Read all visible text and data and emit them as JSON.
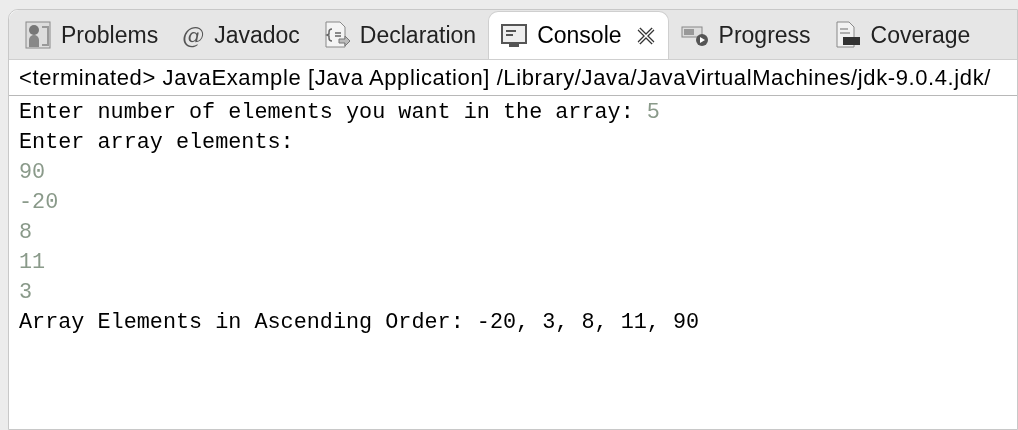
{
  "tabs": [
    {
      "label": "Problems",
      "selected": false,
      "closable": false
    },
    {
      "label": "Javadoc",
      "icon_text": "@",
      "selected": false,
      "closable": false
    },
    {
      "label": "Declaration",
      "selected": false,
      "closable": false
    },
    {
      "label": "Console",
      "selected": true,
      "closable": true
    },
    {
      "label": "Progress",
      "selected": false,
      "closable": false
    },
    {
      "label": "Coverage",
      "selected": false,
      "closable": false
    }
  ],
  "status": "<terminated> JavaExample [Java Application] /Library/Java/JavaVirtualMachines/jdk-9.0.4.jdk/",
  "console_lines": [
    [
      {
        "kind": "output",
        "text": "Enter number of elements you want in the array: "
      },
      {
        "kind": "input",
        "text": "5"
      }
    ],
    [
      {
        "kind": "output",
        "text": "Enter array elements:"
      }
    ],
    [
      {
        "kind": "input",
        "text": "90"
      }
    ],
    [
      {
        "kind": "input",
        "text": "-20"
      }
    ],
    [
      {
        "kind": "input",
        "text": "8"
      }
    ],
    [
      {
        "kind": "input",
        "text": "11"
      }
    ],
    [
      {
        "kind": "input",
        "text": "3"
      }
    ],
    [
      {
        "kind": "output",
        "text": "Array Elements in Ascending Order: -20, 3, 8, 11, 90"
      }
    ]
  ]
}
